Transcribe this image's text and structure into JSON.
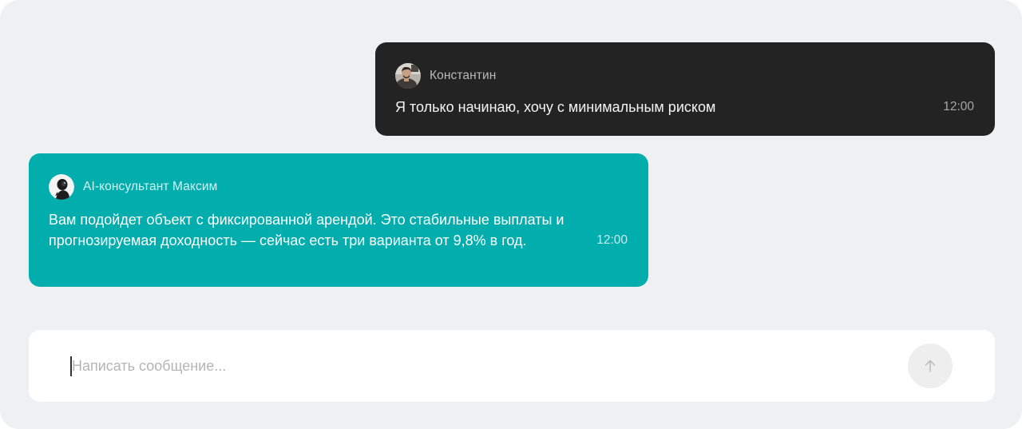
{
  "messages": [
    {
      "role": "user",
      "sender": "Константин",
      "text": "Я только начинаю, хочу с минимальным риском",
      "time": "12:00",
      "avatar_icon": "user-photo-avatar"
    },
    {
      "role": "assistant",
      "sender": "AI-консультант Максим",
      "text": "Вам подойдет объект с фиксированной арендой. Это стабильные выплаты и прогнозируемая доходность — сейчас есть три варианта от 9,8% в год.",
      "time": "12:00",
      "avatar_icon": "ai-robot-avatar"
    }
  ],
  "composer": {
    "placeholder": "Написать сообщение...",
    "value": "",
    "send_icon": "arrow-up-icon"
  },
  "colors": {
    "panel_background": "#eef0f2",
    "user_bubble": "#232323",
    "ai_bubble": "#02adad",
    "composer_background": "#ffffff",
    "send_button": "#eeeeee"
  }
}
